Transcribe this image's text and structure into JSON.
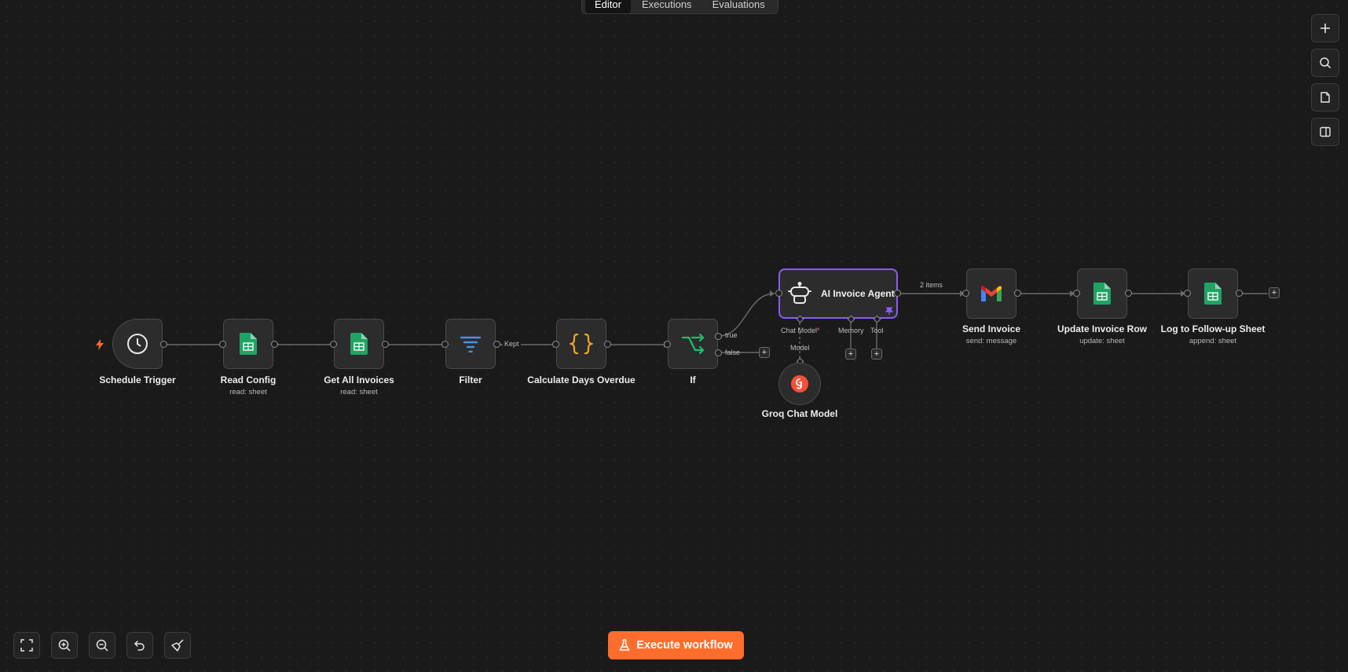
{
  "tabs": [
    {
      "label": "Editor",
      "active": true
    },
    {
      "label": "Executions",
      "active": false
    },
    {
      "label": "Evaluations",
      "active": false
    }
  ],
  "nodes": {
    "schedule_trigger": {
      "label": "Schedule Trigger",
      "icon": "clock-icon"
    },
    "read_config": {
      "label": "Read Config",
      "subtitle": "read: sheet",
      "icon": "google-sheets-icon"
    },
    "get_all_invoices": {
      "label": "Get All Invoices",
      "subtitle": "read: sheet",
      "icon": "google-sheets-icon"
    },
    "filter": {
      "label": "Filter",
      "icon": "filter-icon"
    },
    "calculate_days_overdue": {
      "label": "Calculate Days Overdue",
      "icon": "code-braces-icon"
    },
    "if": {
      "label": "If",
      "icon": "branch-icon"
    },
    "ai_invoice_agent": {
      "label": "AI Invoice Agent",
      "icon": "robot-icon"
    },
    "groq_chat_model": {
      "label": "Groq Chat Model",
      "icon": "groq-icon"
    },
    "send_invoice": {
      "label": "Send Invoice",
      "subtitle": "send: message",
      "icon": "gmail-icon"
    },
    "update_invoice_row": {
      "label": "Update Invoice Row",
      "subtitle": "update: sheet",
      "icon": "google-sheets-icon"
    },
    "log_follow_up": {
      "label": "Log to Follow-up Sheet",
      "subtitle": "append: sheet",
      "icon": "google-sheets-icon"
    }
  },
  "edge_labels": {
    "filter_kept": "Kept",
    "if_true": "true",
    "if_false": "false",
    "agent_items": "2 items"
  },
  "agent_ports": {
    "chat_model": "Chat Model",
    "required_mark": "*",
    "memory": "Memory",
    "tool": "Tool",
    "model": "Model"
  },
  "plus_symbol": "+",
  "execute_button": {
    "label": "Execute workflow"
  },
  "colors": {
    "accent": "#ff6d2d",
    "agent_border": "#8a5cf6",
    "sheets_green": "#1fa463",
    "trigger_bolt": "#ff6d2d",
    "filter_blue": "#4a90e2",
    "code_orange": "#f5a623",
    "if_green": "#1fbf6b",
    "groq_red": "#f55036"
  }
}
